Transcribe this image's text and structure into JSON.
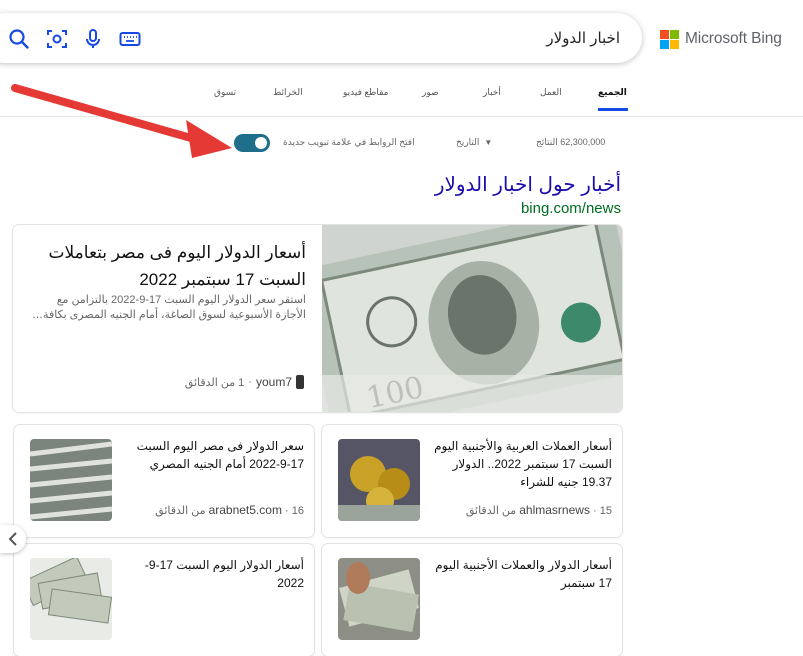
{
  "search": {
    "query": "اخبار الدولار",
    "icons": [
      "search-icon",
      "visual-search-icon",
      "microphone-icon",
      "keyboard-icon"
    ]
  },
  "brand": {
    "name": "Microsoft Bing",
    "colors": [
      "#f25022",
      "#7fba00",
      "#00a4ef",
      "#ffb900"
    ]
  },
  "tabs": [
    {
      "label": "الجميع",
      "active": true
    },
    {
      "label": "العمل"
    },
    {
      "label": "أخبار"
    },
    {
      "label": "صور"
    },
    {
      "label": "مقاطع فيديو"
    },
    {
      "label": "الخرائط"
    },
    {
      "label": "تسوق"
    }
  ],
  "filters": {
    "result_count": "62,300,000 النتائج",
    "date_label": "التاريخ",
    "new_tab_label": "افتح الروابط في علامة تبويب جديدة",
    "toggle_on": true
  },
  "news": {
    "heading": "أخبار حول اخبار الدولار",
    "url": "bing.com/news",
    "featured": {
      "title": "أسعار الدولار اليوم فى مصر بتعاملات السبت 17 سبتمبر 2022",
      "snippet": "استقر سعر الدولار اليوم السبت 17-9-2022 بالتزامن مع الأجازة الأسبوعية لسوق الصاغة، أمام الجنيه المصرى بكافة…",
      "source": "youm7",
      "time": "1 من الدقائق"
    },
    "items": [
      {
        "title": "أسعار العملات العربية والأجنبية اليوم السبت 17 سبتمبر 2022.. الدولار 19.37 جنيه للشراء",
        "source": "ahlmasrnews",
        "time": "15 من الدقائق"
      },
      {
        "title": "سعر الدولار فى مصر اليوم السبت 17-9-2022 أمام الجنيه المصري",
        "source": "arabnet5.com",
        "time": "16 من الدقائق"
      },
      {
        "title": "أسعار الدولار والعملات الأجنبية اليوم 17 سبتمبر",
        "source": "",
        "time": ""
      },
      {
        "title": "أسعار الدولار اليوم السبت 17-9-2022",
        "source": "",
        "time": ""
      }
    ]
  },
  "annotation": {
    "arrow_color": "#e53935"
  }
}
